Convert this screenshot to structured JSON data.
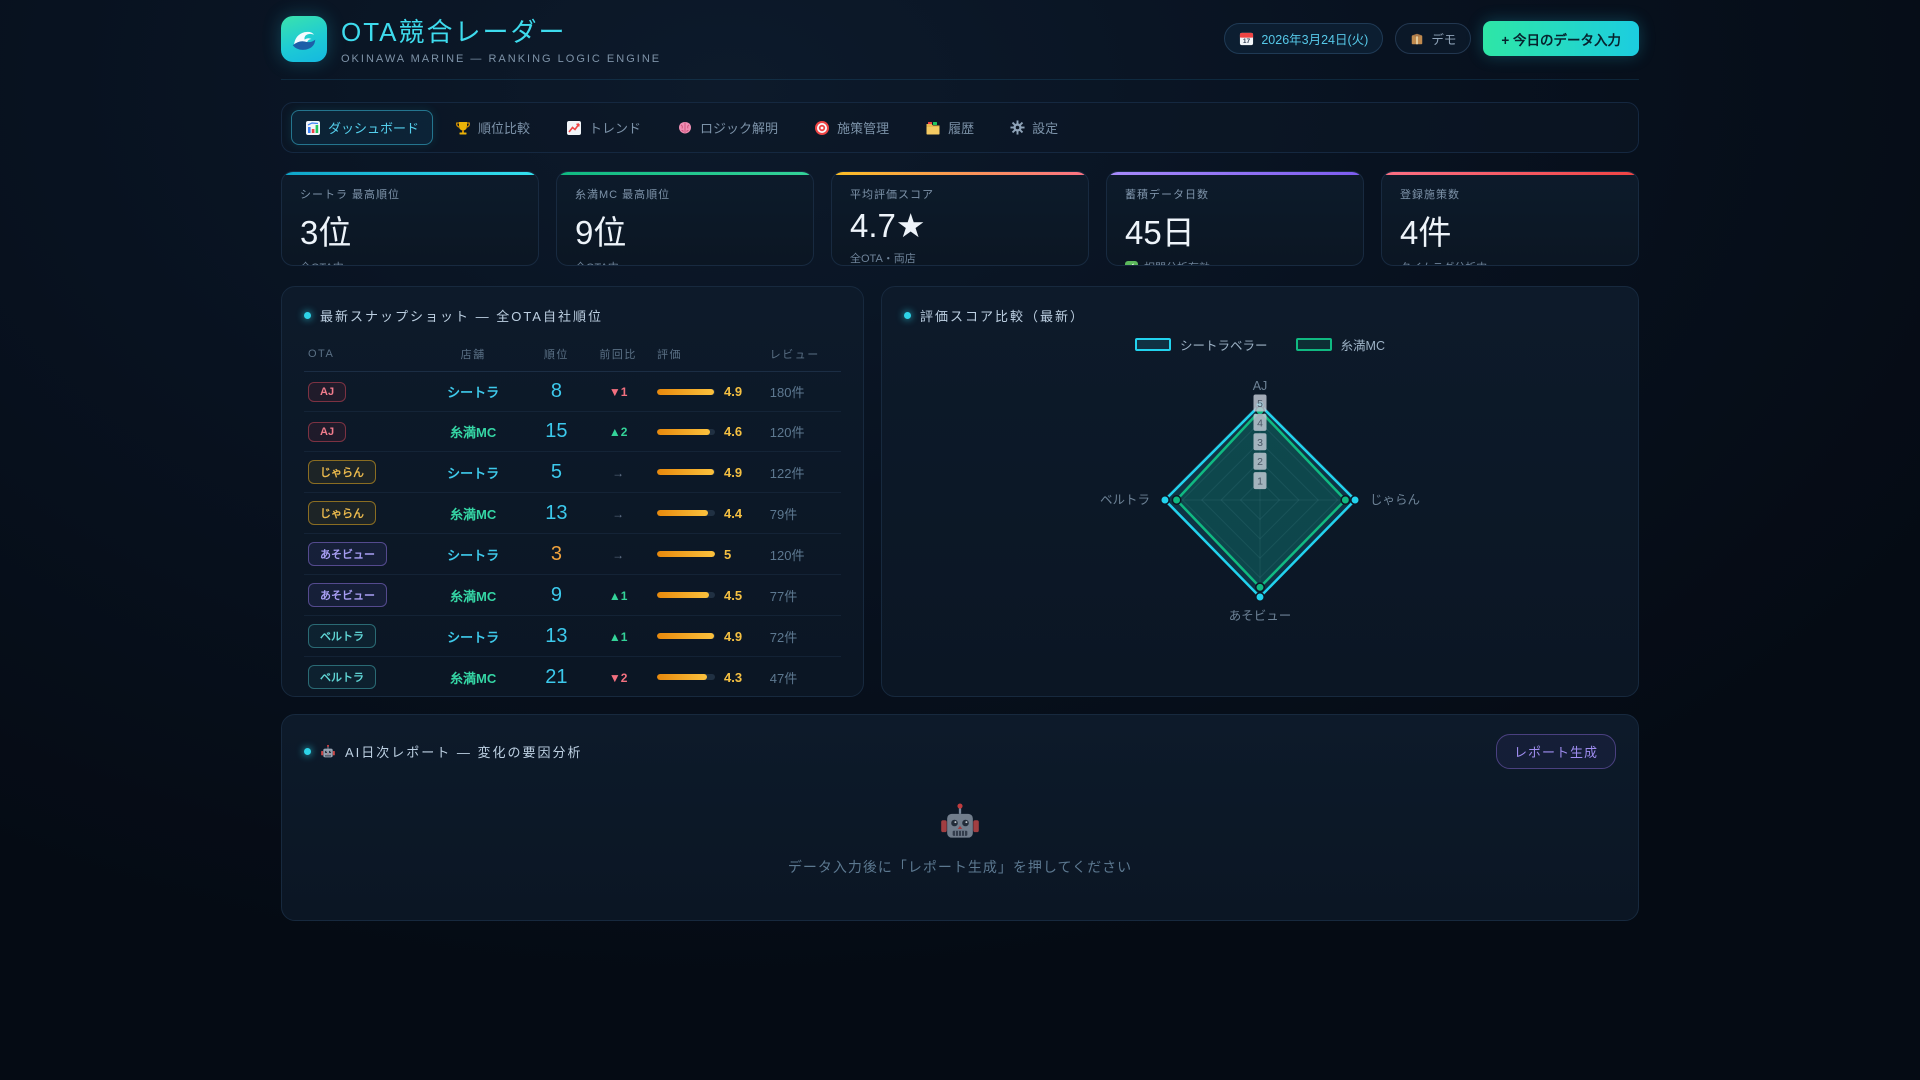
{
  "header": {
    "app_title": "OTA競合レーダー",
    "subtitle": "OKINAWA MARINE — RANKING LOGIC ENGINE",
    "date_badge": "2026年3月24日(火)",
    "demo_badge": "デモ",
    "cta_button": "+ 今日のデータ入力"
  },
  "nav": {
    "tabs": [
      {
        "label": "ダッシュボード",
        "icon": "dashboard-icon",
        "active": true
      },
      {
        "label": "順位比較",
        "icon": "trophy-icon",
        "active": false
      },
      {
        "label": "トレンド",
        "icon": "trend-icon",
        "active": false
      },
      {
        "label": "ロジック解明",
        "icon": "brain-icon",
        "active": false
      },
      {
        "label": "施策管理",
        "icon": "target-icon",
        "active": false
      },
      {
        "label": "履歴",
        "icon": "folder-icon",
        "active": false
      },
      {
        "label": "設定",
        "icon": "gear-icon",
        "active": false
      }
    ]
  },
  "kpi_cards": [
    {
      "label": "シートラ 最高順位",
      "value": "3位",
      "sub": "全OTA中 →",
      "accent": [
        "#0ea5c9",
        "#34e2f0"
      ],
      "check": false
    },
    {
      "label": "糸満MC 最高順位",
      "value": "9位",
      "sub": "全OTA中",
      "accent": [
        "#10b981",
        "#34d399"
      ],
      "check": false
    },
    {
      "label": "平均評価スコア",
      "value": "4.7★",
      "sub": "全OTA・両店",
      "accent": [
        "#fbbf24",
        "#fb7185"
      ],
      "check": false
    },
    {
      "label": "蓄積データ日数",
      "value": "45日",
      "sub": "相関分析有効",
      "accent": [
        "#a78bfa",
        "#7c5cf0"
      ],
      "check": true
    },
    {
      "label": "登録施策数",
      "value": "4件",
      "sub": "タイムラグ分析中",
      "accent": [
        "#fb7185",
        "#ef4444"
      ],
      "check": false
    }
  ],
  "snapshot": {
    "title": "最新スナップショット — 全OTA自社順位",
    "columns": [
      "OTA",
      "店舗",
      "順位",
      "前回比",
      "評価",
      "レビュー"
    ],
    "badge_styles": {
      "AJ": {
        "color": "#f07c8c",
        "border": "#7c3242",
        "bg": "rgba(150,40,60,0.14)"
      },
      "じゃらん": {
        "color": "#eab94d",
        "border": "#8a6d22",
        "bg": "rgba(160,120,30,0.12)"
      },
      "あそビュー": {
        "color": "#a79df2",
        "border": "#544a8e",
        "bg": "rgba(100,90,200,0.12)"
      },
      "ベルトラ": {
        "color": "#5fd4d4",
        "border": "#2a6a74",
        "bg": "rgba(40,140,150,0.10)"
      }
    },
    "shop_colors": {
      "シートラ": "#3ec9ea",
      "糸満MC": "#35d6a5"
    },
    "rows": [
      {
        "ota": "AJ",
        "shop": "シートラ",
        "rank": 8,
        "change": "▼1",
        "change_dir": "down",
        "rating": 4.9,
        "rating_display": "4.9",
        "reviews": "180件"
      },
      {
        "ota": "AJ",
        "shop": "糸満MC",
        "rank": 15,
        "change": "▲2",
        "change_dir": "up",
        "rating": 4.6,
        "rating_display": "4.6",
        "reviews": "120件"
      },
      {
        "ota": "じゃらん",
        "shop": "シートラ",
        "rank": 5,
        "change": "→",
        "change_dir": "flat",
        "rating": 4.9,
        "rating_display": "4.9",
        "reviews": "122件"
      },
      {
        "ota": "じゃらん",
        "shop": "糸満MC",
        "rank": 13,
        "change": "→",
        "change_dir": "flat",
        "rating": 4.4,
        "rating_display": "4.4",
        "reviews": "79件"
      },
      {
        "ota": "あそビュー",
        "shop": "シートラ",
        "rank": 3,
        "change": "→",
        "change_dir": "flat",
        "rating": 5.0,
        "rating_display": "5",
        "reviews": "120件"
      },
      {
        "ota": "あそビュー",
        "shop": "糸満MC",
        "rank": 9,
        "change": "▲1",
        "change_dir": "up",
        "rating": 4.5,
        "rating_display": "4.5",
        "reviews": "77件"
      },
      {
        "ota": "ベルトラ",
        "shop": "シートラ",
        "rank": 13,
        "change": "▲1",
        "change_dir": "up",
        "rating": 4.9,
        "rating_display": "4.9",
        "reviews": "72件"
      },
      {
        "ota": "ベルトラ",
        "shop": "糸満MC",
        "rank": 21,
        "change": "▼2",
        "change_dir": "down",
        "rating": 4.3,
        "rating_display": "4.3",
        "reviews": "47件"
      }
    ]
  },
  "chart_data": {
    "type": "radar",
    "title": "評価スコア比較（最新）",
    "categories": [
      "AJ",
      "じゃらん",
      "あそビュー",
      "ベルトラ"
    ],
    "series": [
      {
        "name": "シートラベラー",
        "color": "#22d3ee",
        "values": [
          4.9,
          4.9,
          5.0,
          4.9
        ]
      },
      {
        "name": "糸満MC",
        "color": "#10b981",
        "values": [
          4.6,
          4.4,
          4.5,
          4.3
        ]
      }
    ],
    "ticks": [
      1,
      2,
      3,
      4,
      5
    ],
    "max": 5,
    "legend_position": "top",
    "grid": true
  },
  "report": {
    "title": "AI日次レポート — 変化の要因分析",
    "button": "レポート生成",
    "empty_text": "データ入力後に「レポート生成」を押してください"
  }
}
